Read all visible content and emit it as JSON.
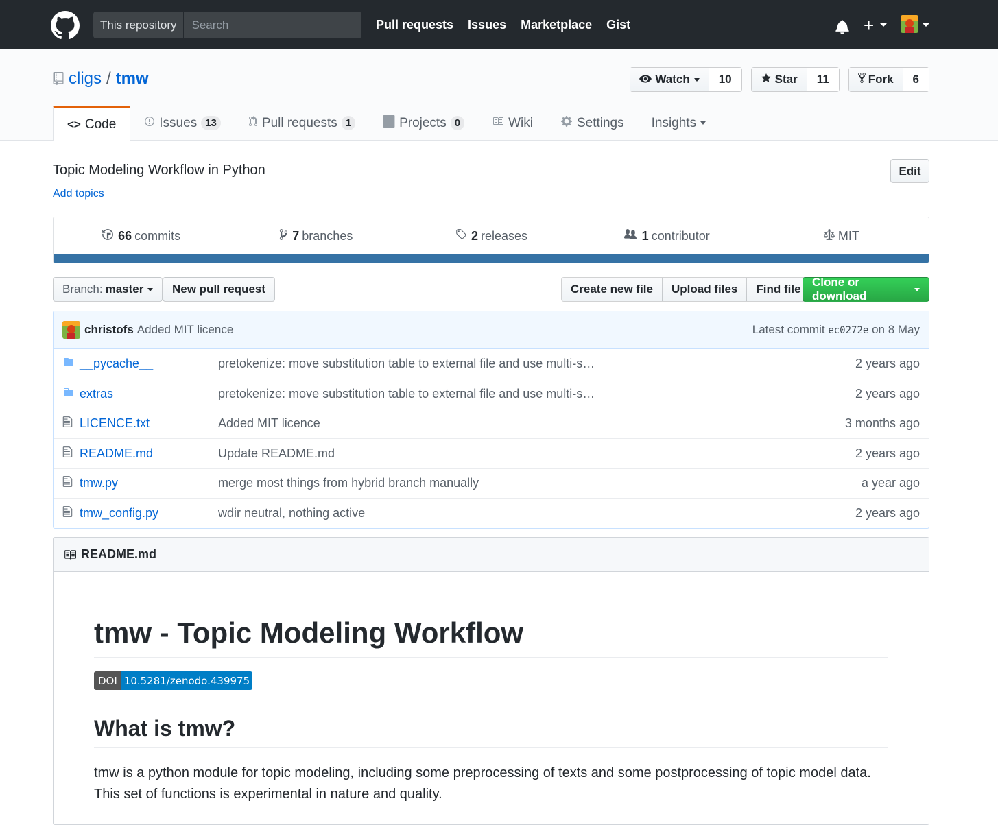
{
  "header": {
    "search_scope": "This repository",
    "search_placeholder": "Search",
    "nav": [
      "Pull requests",
      "Issues",
      "Marketplace",
      "Gist"
    ]
  },
  "repo": {
    "owner": "cligs",
    "separator": "/",
    "name": "tmw",
    "watch_label": "Watch",
    "watch_count": "10",
    "star_label": "Star",
    "star_count": "11",
    "fork_label": "Fork",
    "fork_count": "6"
  },
  "tabs": [
    {
      "label": "Code"
    },
    {
      "label": "Issues",
      "count": "13"
    },
    {
      "label": "Pull requests",
      "count": "1"
    },
    {
      "label": "Projects",
      "count": "0"
    },
    {
      "label": "Wiki"
    },
    {
      "label": "Settings"
    },
    {
      "label": "Insights"
    }
  ],
  "description": "Topic Modeling Workflow in Python",
  "add_topics": "Add topics",
  "edit_label": "Edit",
  "summary": {
    "commits_num": "66",
    "commits_label": "commits",
    "branches_num": "7",
    "branches_label": "branches",
    "releases_num": "2",
    "releases_label": "releases",
    "contributors_num": "1",
    "contributors_label": "contributor",
    "license": "MIT",
    "language_color": "#3572A5"
  },
  "filebar": {
    "branch_prefix": "Branch:",
    "branch": "master",
    "new_pr": "New pull request",
    "create_file": "Create new file",
    "upload_files": "Upload files",
    "find_file": "Find file",
    "clone": "Clone or download"
  },
  "latest_commit": {
    "author": "christofs",
    "message": "Added MIT licence",
    "prefix": "Latest commit",
    "sha": "ec0272e",
    "date": "on 8 May"
  },
  "files": [
    {
      "name": "__pycache__",
      "type": "dir",
      "message": "pretokenize: move substitution table to external file and use multi-s…",
      "age": "2 years ago"
    },
    {
      "name": "extras",
      "type": "dir",
      "message": "pretokenize: move substitution table to external file and use multi-s…",
      "age": "2 years ago"
    },
    {
      "name": "LICENCE.txt",
      "type": "file",
      "message": "Added MIT licence",
      "age": "3 months ago"
    },
    {
      "name": "README.md",
      "type": "file",
      "message": "Update README.md",
      "age": "2 years ago"
    },
    {
      "name": "tmw.py",
      "type": "file",
      "message": "merge most things from hybrid branch manually",
      "age": "a year ago"
    },
    {
      "name": "tmw_config.py",
      "type": "file",
      "message": "wdir neutral, nothing active",
      "age": "2 years ago"
    }
  ],
  "readme": {
    "filename": "README.md",
    "h1": "tmw - Topic Modeling Workflow",
    "doi_label": "DOI",
    "doi_value": "10.5281/zenodo.439975",
    "h2": "What is tmw?",
    "paragraph": "tmw is a python module for topic modeling, including some preprocessing of texts and some postprocessing of topic model data. This set of functions is experimental in nature and quality."
  }
}
